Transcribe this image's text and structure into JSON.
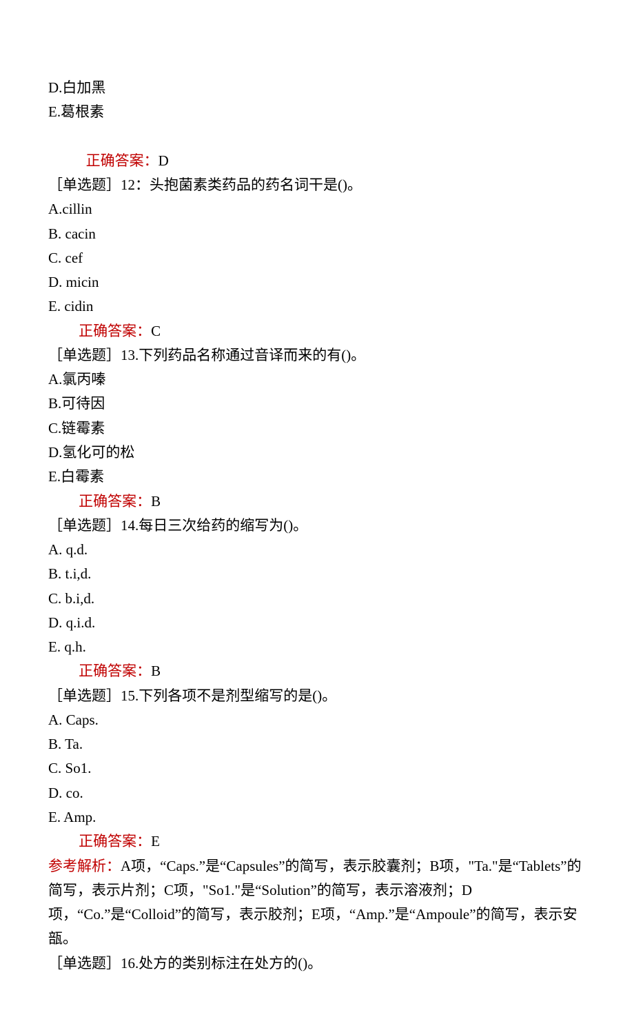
{
  "labels": {
    "correct_answer": "正确答案：",
    "explain": "参考解析："
  },
  "pre_options": [
    {
      "label": "D.",
      "text": "白加黑"
    },
    {
      "label": "E.",
      "text": "葛根素"
    }
  ],
  "pre_answer": "D",
  "questions": [
    {
      "tag": "［单选题］",
      "number": "12：",
      "stem": "头抱菌素类药品的药名词干是()。",
      "options": [
        {
          "label": "A.",
          "text": "cillin",
          "join": ""
        },
        {
          "label": "B.",
          "text": "cacin",
          "join": " "
        },
        {
          "label": "C.",
          "text": "cef",
          "join": " "
        },
        {
          "label": "D.",
          "text": "micin",
          "join": " "
        },
        {
          "label": "E.",
          "text": "cidin",
          "join": " "
        }
      ],
      "answer": "C"
    },
    {
      "tag": "［单选题］",
      "number": "13.",
      "stem": "下列药品名称通过音译而来的有()。",
      "options": [
        {
          "label": "A.",
          "text": "氯丙嗪",
          "join": ""
        },
        {
          "label": "B.",
          "text": "可待因",
          "join": ""
        },
        {
          "label": "C.",
          "text": "链霉素",
          "join": ""
        },
        {
          "label": "D.",
          "text": "氢化可的松",
          "join": ""
        },
        {
          "label": "E.",
          "text": "白霉素",
          "join": ""
        }
      ],
      "answer": "B"
    },
    {
      "tag": "［单选题］",
      "number": "14.",
      "stem": "每日三次给药的缩写为()。",
      "options": [
        {
          "label": "A.",
          "text": "q.d.",
          "join": " "
        },
        {
          "label": "B.",
          "text": "t.i,d.",
          "join": " "
        },
        {
          "label": "C.",
          "text": "b.i,d.",
          "join": " "
        },
        {
          "label": "D.",
          "text": "q.i.d.",
          "join": " "
        },
        {
          "label": "E.",
          "text": "q.h.",
          "join": " "
        }
      ],
      "answer": "B"
    },
    {
      "tag": "［单选题］",
      "number": "15.",
      "stem": "下列各项不是剂型缩写的是()。",
      "options": [
        {
          "label": "A.",
          "text": "Caps.",
          "join": " "
        },
        {
          "label": "B.",
          "text": "Ta.",
          "join": " "
        },
        {
          "label": "C.",
          "text": "So1.",
          "join": " "
        },
        {
          "label": "D.",
          "text": "co.",
          "join": " "
        },
        {
          "label": "E.",
          "text": "Amp.",
          "join": " "
        }
      ],
      "answer": "E",
      "explain": "A项，“Caps.”是“Capsules”的简写，表示胶囊剂；B项，\"Ta.\"是“Tablets”的简写，表示片剂；C项，\"So1.\"是“Solution”的简写，表示溶液剂；D项，“Co.”是“Colloid”的简写，表示胶剂；E项，“Amp.”是“Ampoule”的简写，表示安瓿。"
    },
    {
      "tag": "［单选题］",
      "number": "16.",
      "stem": "处方的类别标注在处方的()。"
    }
  ]
}
